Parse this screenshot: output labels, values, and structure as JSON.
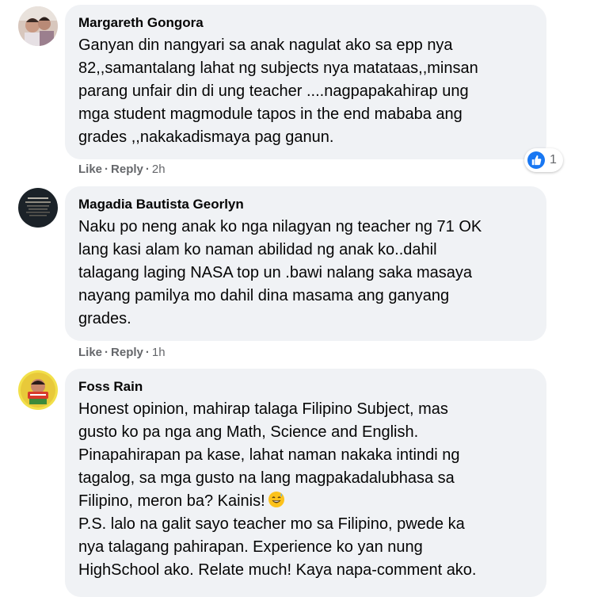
{
  "comments": [
    {
      "author": "Margareth Gongora",
      "lines": [
        "Ganyan din nangyari sa anak nagulat ako sa epp nya",
        "82,,samantalang lahat ng subjects nya matataas,,minsan",
        "parang unfair din di ung teacher ....nagpapakahirap ung",
        "mga student magmodule tapos in the end mababa ang",
        "grades ,,nakakadismaya pag ganun."
      ],
      "like_label": "Like",
      "reply_label": "Reply",
      "separator": "·",
      "time": "2h",
      "reaction_count": "1"
    },
    {
      "author": "Magadia Bautista Georlyn",
      "lines": [
        "Naku po neng anak ko nga nilagyan ng teacher ng 71 OK",
        "lang kasi alam ko naman abilidad ng anak ko..dahil",
        "talagang laging NASA top un .bawi nalang saka masaya",
        "nayang pamilya mo dahil dina masama ang ganyang",
        "grades."
      ],
      "like_label": "Like",
      "reply_label": "Reply",
      "separator": "·",
      "time": "1h"
    },
    {
      "author": "Foss Rain",
      "lines": [
        "Honest opinion, mahirap talaga Filipino Subject, mas",
        "gusto ko pa nga ang Math, Science and English.",
        "Pinapahirapan pa kase, lahat naman nakaka intindi ng",
        "tagalog, sa mga gusto na lang magpakadalubhasa sa",
        "Filipino, meron ba? Kainis!",
        "P.S. lalo na galit sayo teacher mo sa Filipino, pwede ka",
        "nya talagang pahirapan. Experience ko yan nung",
        "HighSchool ako. Relate much! Kaya napa-comment ako."
      ],
      "emoji_icon": "grinning-sweat-emoji-icon"
    }
  ],
  "colors": {
    "bubble": "#f0f2f5",
    "meta": "#65676b",
    "like_blue": "#1877f2"
  }
}
